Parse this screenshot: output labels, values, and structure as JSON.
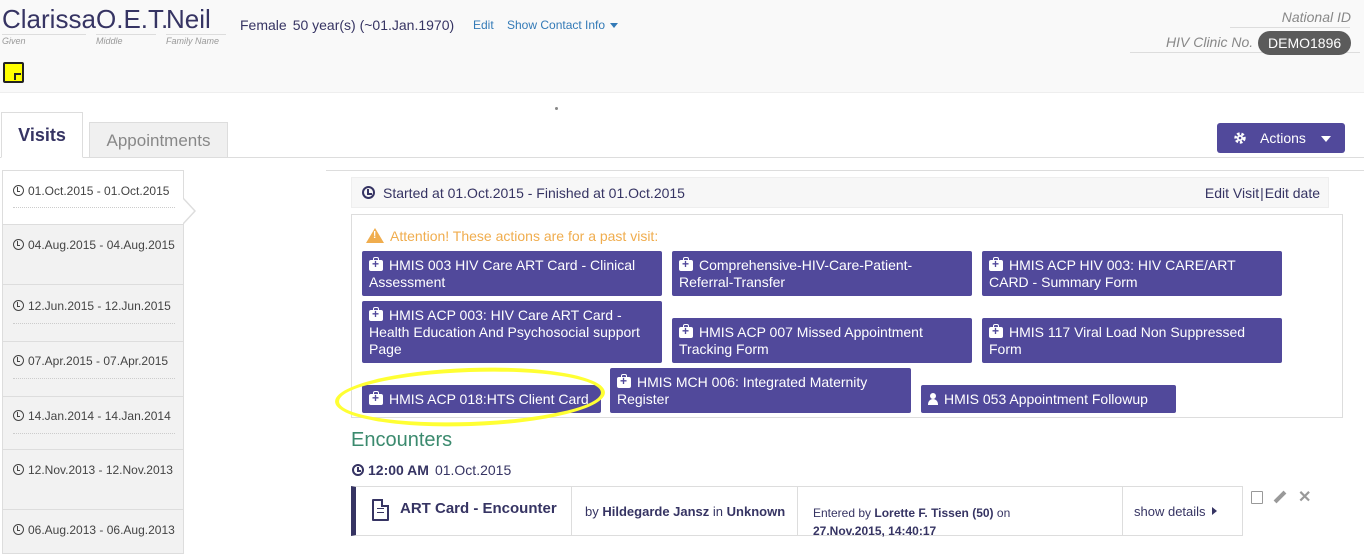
{
  "patient": {
    "given": "Clarissa",
    "middle": "O.E.T.",
    "family": "Neil",
    "given_label": "Given",
    "middle_label": "Middle",
    "family_label": "Family Name",
    "gender": "Female",
    "age": "50 year(s) (~01.Jan.1970)",
    "edit_link": "Edit",
    "contact_link": "Show Contact Info"
  },
  "identifiers": {
    "national_id_label": "National ID",
    "hiv_clinic_label": "HIV Clinic No.",
    "hiv_clinic_value": "DEMO1896"
  },
  "tabs": [
    {
      "label": "Visits",
      "active": true
    },
    {
      "label": "Appointments",
      "active": false
    }
  ],
  "actions_button": {
    "label": "Actions"
  },
  "visits": [
    {
      "range": "01.Oct.2015 - 01.Oct.2015",
      "active": true
    },
    {
      "range": "04.Aug.2015 - 04.Aug.2015",
      "active": false
    },
    {
      "range": "12.Jun.2015 - 12.Jun.2015",
      "active": false
    },
    {
      "range": "07.Apr.2015 - 07.Apr.2015",
      "active": false
    },
    {
      "range": "14.Jan.2014 - 14.Jan.2014",
      "active": false
    },
    {
      "range": "12.Nov.2013 - 12.Nov.2013",
      "active": false
    },
    {
      "range": "06.Aug.2013 - 06.Aug.2013",
      "active": false
    }
  ],
  "visit_summary": {
    "started": "Started at 01.Oct.2015 - Finished at 01.Oct.2015",
    "edit_visit": "Edit Visit",
    "separator": "|",
    "edit_date": "Edit date"
  },
  "attention": "Attention! These actions are for a past visit:",
  "form_buttons": [
    {
      "label": "HMIS 003 HIV Care ART Card - Clinical Assessment",
      "icon": "medkit-icon"
    },
    {
      "label": "Comprehensive-HIV-Care-Patient-Referral-Transfer",
      "icon": "medkit-icon"
    },
    {
      "label": "HMIS ACP HIV 003: HIV CARE/ART CARD - Summary Form",
      "icon": "medkit-icon"
    },
    {
      "label": "HMIS ACP 003: HIV Care ART Card - Health Education And Psychosocial support Page",
      "icon": "medkit-icon"
    },
    {
      "label": "HMIS ACP 007 Missed Appointment Tracking Form",
      "icon": "medkit-icon"
    },
    {
      "label": "HMIS 117 Viral Load Non Suppressed Form",
      "icon": "medkit-icon"
    },
    {
      "label": "HMIS ACP 018:HTS Client Card",
      "icon": "medkit-icon"
    },
    {
      "label": "HMIS MCH 006: Integrated Maternity Register",
      "icon": "medkit-icon"
    },
    {
      "label": "HMIS 053 Appointment Followup",
      "icon": "user-icon"
    }
  ],
  "encounters": {
    "heading": "Encounters",
    "time": "12:00 AM",
    "date": "01.Oct.2015",
    "row": {
      "title": "ART Card - Encounter",
      "by_prefix": "by",
      "provider": "Hildegarde Jansz",
      "in_word": "in",
      "location": "Unknown",
      "entered_prefix": "Entered by",
      "entered_by": "Lorette F. Tissen (50)",
      "on_word": "on",
      "entered_on": "27.Nov.2015, 14:40:17",
      "show_details": "show details"
    }
  },
  "colors": {
    "primary": "#51499b",
    "text": "#363463",
    "encounters_heading": "#3b8a6e",
    "warning": "#f0ad4e",
    "highlight": "#ffff33"
  }
}
